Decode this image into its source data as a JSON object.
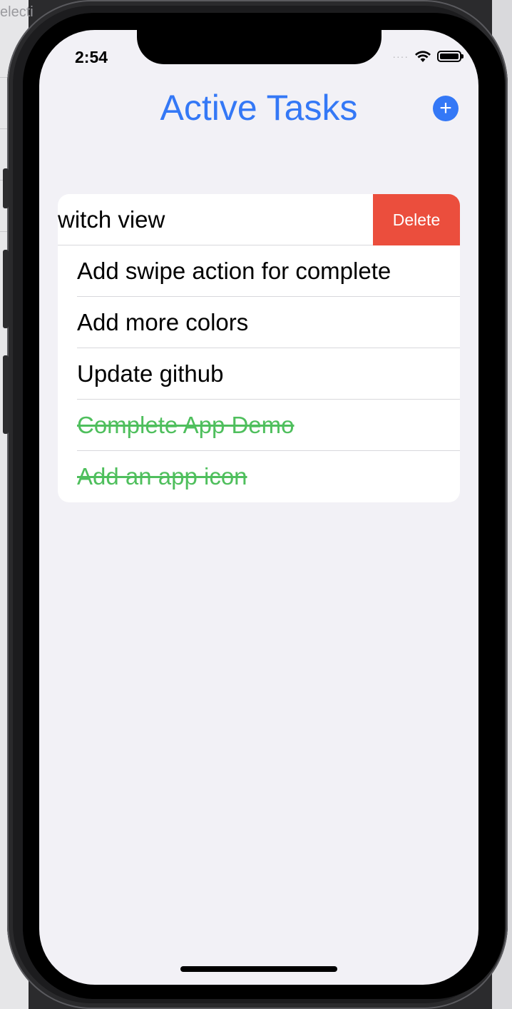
{
  "host": {
    "fragment_text": "electi"
  },
  "status_bar": {
    "time": "2:54",
    "signal": "····"
  },
  "nav": {
    "title": "Active Tasks",
    "add_icon": "plus-circle-icon"
  },
  "colors": {
    "accent": "#3478f6",
    "completed": "#4fbf5d",
    "delete": "#eb4e3d",
    "background": "#f2f1f6"
  },
  "tasks": [
    {
      "label": "witch view",
      "completed": false,
      "swiped": true,
      "action_label": "Delete"
    },
    {
      "label": "Add swipe action for complete",
      "completed": false
    },
    {
      "label": "Add more colors",
      "completed": false
    },
    {
      "label": "Update github",
      "completed": false
    },
    {
      "label": "Complete App Demo",
      "completed": true
    },
    {
      "label": "Add an app icon",
      "completed": true
    }
  ]
}
